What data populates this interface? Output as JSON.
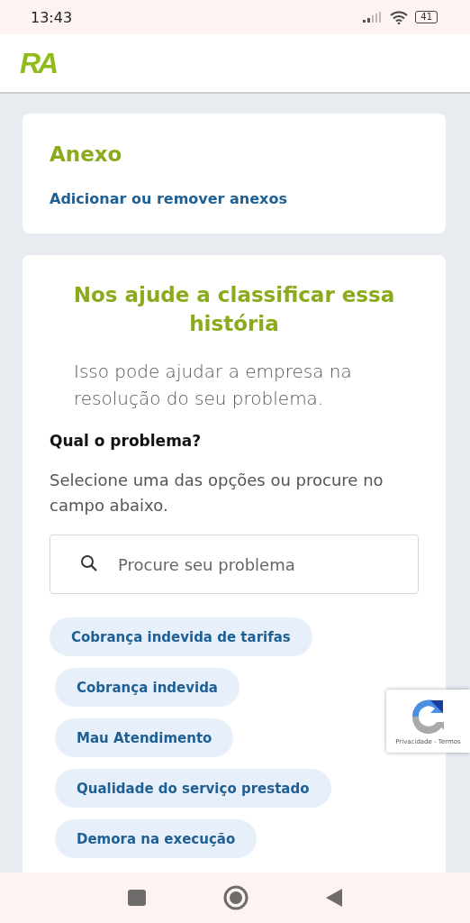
{
  "status_bar": {
    "time": "13:43",
    "battery": "41"
  },
  "header": {
    "logo": "RA"
  },
  "attachment_card": {
    "title": "Anexo",
    "link": "Adicionar ou remover anexos"
  },
  "classify_card": {
    "title": "Nos ajude a classificar essa história",
    "intro": "Isso pode ajudar a empresa na resolução do seu problema.",
    "question": "Qual o problema?",
    "hint": "Selecione uma das opções ou procure no campo abaixo.",
    "search": {
      "placeholder": "Procure seu problema"
    },
    "options": [
      {
        "label": "Cobrança indevida de tarifas",
        "selected": false
      },
      {
        "label": "Cobrança indevida",
        "selected": false
      },
      {
        "label": "Mau Atendimento",
        "selected": false
      },
      {
        "label": "Qualidade do serviço prestado",
        "selected": false
      },
      {
        "label": "Demora na execução",
        "selected": false
      }
    ]
  },
  "recaptcha": {
    "links": "Privacidade - Termos"
  }
}
